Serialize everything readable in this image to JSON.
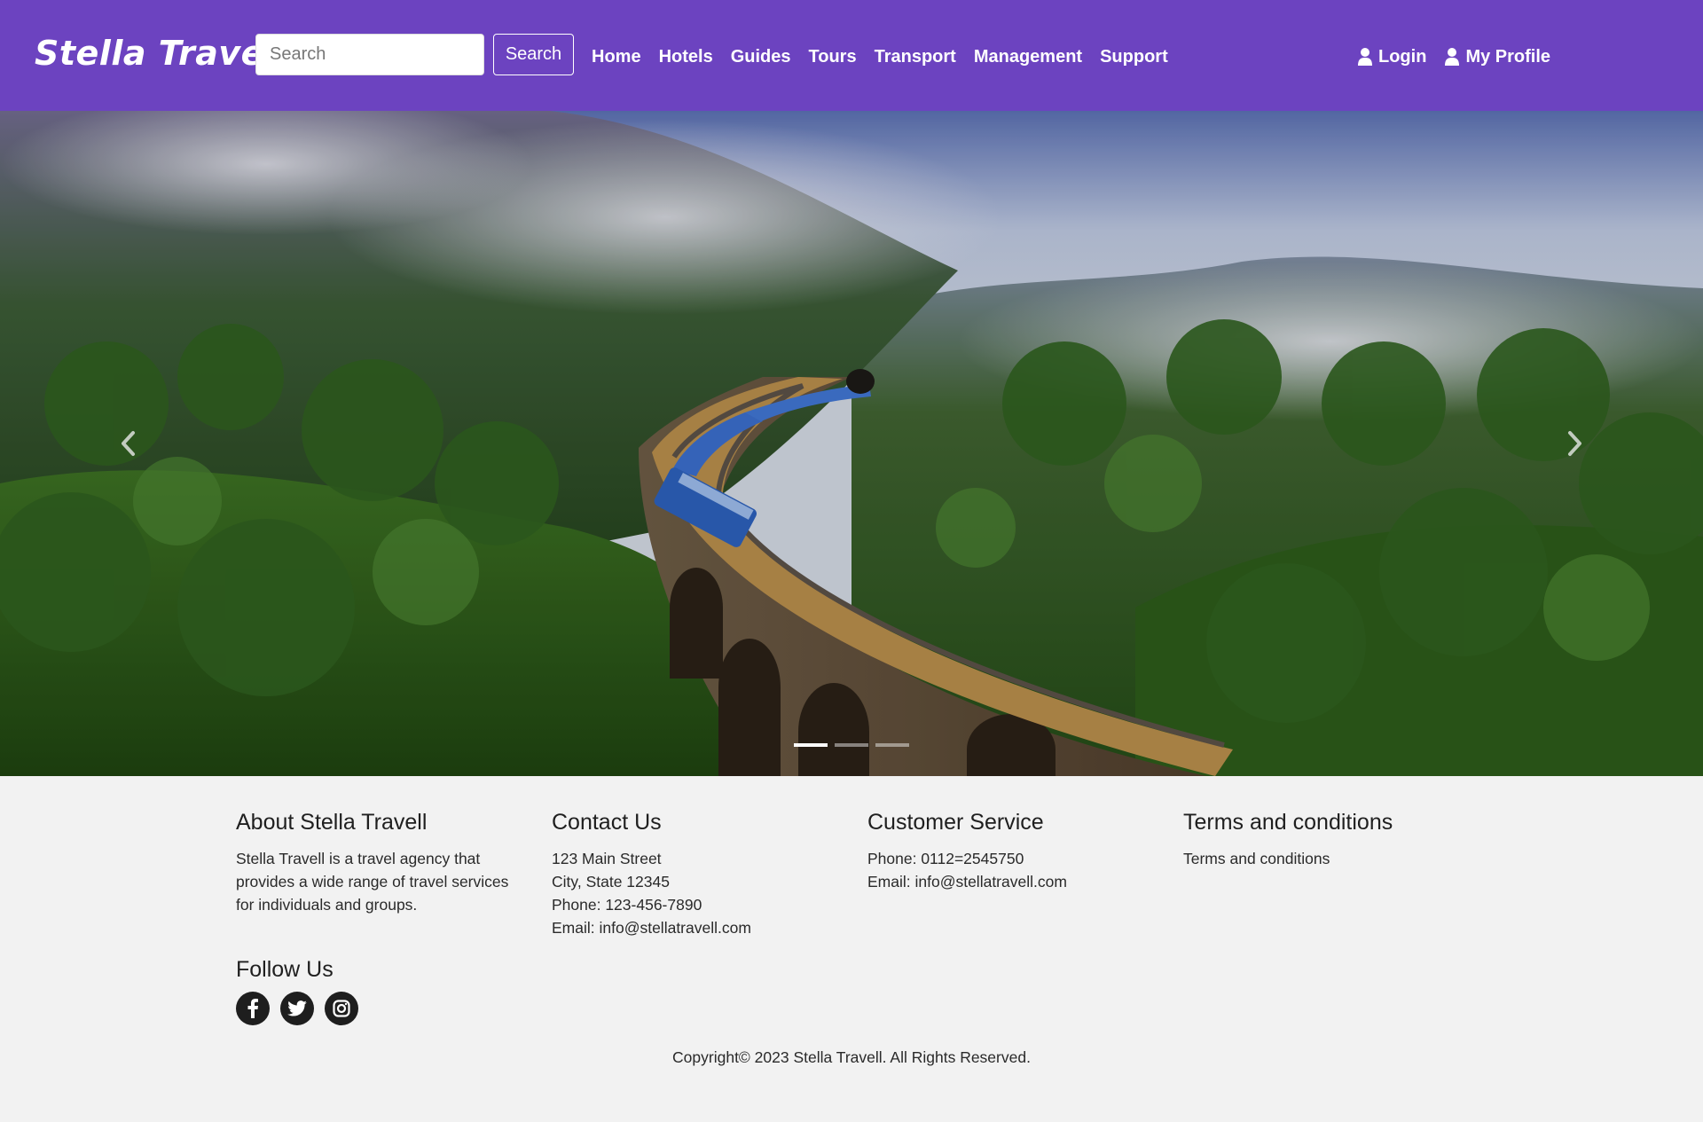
{
  "navbar": {
    "brand": "Stella Travel",
    "search_placeholder": "Search",
    "search_button": "Search",
    "links": [
      "Home",
      "Hotels",
      "Guides",
      "Tours",
      "Transport",
      "Management",
      "Support"
    ],
    "login": "Login",
    "profile": "My Profile",
    "bg_color": "#6c43c0"
  },
  "carousel": {
    "prev_icon": "chevron-left-icon",
    "next_icon": "chevron-right-icon",
    "slide_count": 3,
    "active_slide": 1
  },
  "footer": {
    "about": {
      "title": "About Stella Travell",
      "text": "Stella Travell is a travel agency that provides a wide range of travel services for individuals and groups."
    },
    "contact": {
      "title": "Contact Us",
      "lines": [
        "123 Main Street",
        "City, State 12345",
        "Phone: 123-456-7890",
        "Email: info@stellatravell.com"
      ]
    },
    "service": {
      "title": "Customer Service",
      "lines": [
        "Phone: 0112=2545750",
        "Email: info@stellatravell.com"
      ]
    },
    "terms": {
      "title": "Terms and conditions",
      "link": "Terms and conditions"
    },
    "follow": {
      "title": "Follow Us",
      "icons": [
        "facebook-icon",
        "twitter-icon",
        "instagram-icon"
      ]
    },
    "copyright": "Copyright© 2023 Stella Travell. All Rights Reserved."
  }
}
